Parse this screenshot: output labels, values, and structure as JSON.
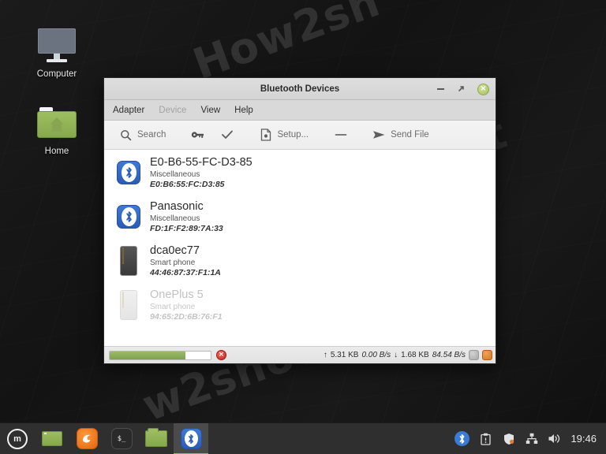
{
  "desktop": {
    "icons": [
      {
        "label": "Computer",
        "icon": "computer-monitor-icon"
      },
      {
        "label": "Home",
        "icon": "home-folder-icon"
      }
    ],
    "watermarks": [
      "How2sh",
      "How2shout",
      "w2shout"
    ]
  },
  "window": {
    "title": "Bluetooth Devices",
    "buttons": {
      "minimize": "minimize-icon",
      "maximize": "maximize-icon",
      "close": "close-icon",
      "close_glyph": "×"
    },
    "menu": [
      {
        "label": "Adapter",
        "disabled": false
      },
      {
        "label": "Device",
        "disabled": true
      },
      {
        "label": "View",
        "disabled": false
      },
      {
        "label": "Help",
        "disabled": false
      }
    ],
    "toolbar": [
      {
        "label": "Search",
        "icon": "search-icon"
      },
      {
        "label": "",
        "icon": "key-icon"
      },
      {
        "label": "",
        "icon": "check-icon"
      },
      {
        "label": "Setup...",
        "icon": "setup-document-icon"
      },
      {
        "label": "",
        "icon": "minus-icon"
      },
      {
        "label": "Send File",
        "icon": "send-file-icon"
      }
    ],
    "devices": [
      {
        "name": "E0-B6-55-FC-D3-85",
        "type": "Miscellaneous",
        "mac": "E0:B6:55:FC:D3:85",
        "icon": "bluetooth-device-icon",
        "dimmed": false
      },
      {
        "name": "Panasonic",
        "type": "Miscellaneous",
        "mac": "FD:1F:F2:89:7A:33",
        "icon": "bluetooth-device-icon",
        "dimmed": false
      },
      {
        "name": "dca0ec77",
        "type": "Smart phone",
        "mac": "44:46:87:37:F1:1A",
        "icon": "smartphone-icon",
        "dimmed": false
      },
      {
        "name": "OnePlus 5",
        "type": "Smart phone",
        "mac": "94:65:2D:6B:76:F1",
        "icon": "smartphone-icon",
        "dimmed": true
      }
    ],
    "statusbar": {
      "progress_percent": 75,
      "cancel_glyph": "×",
      "upload_arrow": "↑",
      "upload_total": "5.31 KB",
      "upload_rate": "0.00 B/s",
      "download_arrow": "↓",
      "download_total": "1.68 KB",
      "download_rate": "84.54 B/s",
      "tray_icons": [
        "globe-icon",
        "transfer-icon"
      ]
    }
  },
  "taskbar": {
    "menu_button": "mint-menu-icon",
    "menu_letter": "m",
    "launchers": [
      {
        "name": "show-desktop",
        "icon": "window-icon"
      },
      {
        "name": "firefox",
        "icon": "firefox-icon"
      },
      {
        "name": "terminal",
        "icon": "terminal-icon",
        "glyph": "$_"
      },
      {
        "name": "files",
        "icon": "folder-icon"
      },
      {
        "name": "bluetooth-window",
        "icon": "bluetooth-icon",
        "active": true
      }
    ],
    "tray": [
      {
        "name": "bluetooth-tray-icon"
      },
      {
        "name": "clipboard-tray-icon"
      },
      {
        "name": "update-shield-tray-icon"
      },
      {
        "name": "network-tray-icon"
      },
      {
        "name": "volume-tray-icon"
      }
    ],
    "clock": "19:46"
  },
  "colors": {
    "accent_blue": "#2a5cb8",
    "mint_green": "#8fbb4a",
    "taskbar_bg": "#2f2f2f"
  }
}
